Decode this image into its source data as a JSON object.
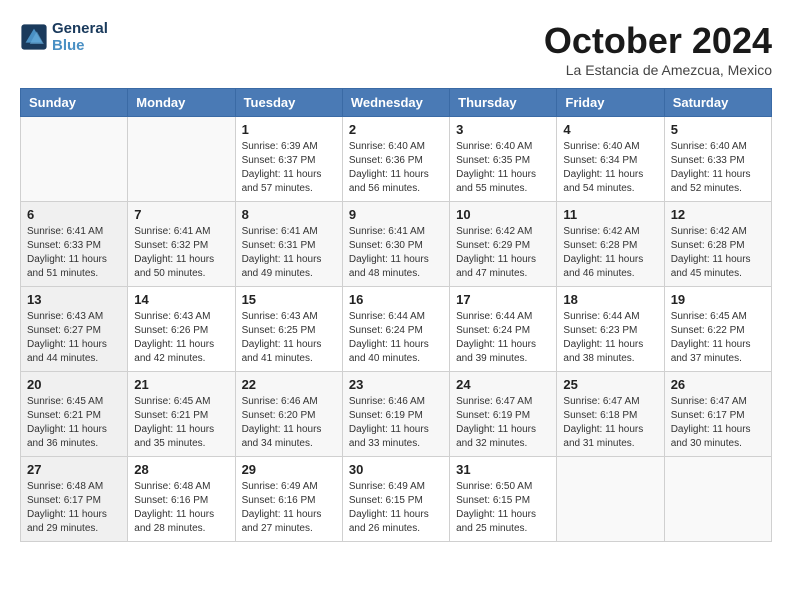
{
  "header": {
    "logo_line1": "General",
    "logo_line2": "Blue",
    "month": "October 2024",
    "location": "La Estancia de Amezcua, Mexico"
  },
  "weekdays": [
    "Sunday",
    "Monday",
    "Tuesday",
    "Wednesday",
    "Thursday",
    "Friday",
    "Saturday"
  ],
  "weeks": [
    [
      {
        "day": "",
        "sunrise": "",
        "sunset": "",
        "daylight": ""
      },
      {
        "day": "",
        "sunrise": "",
        "sunset": "",
        "daylight": ""
      },
      {
        "day": "1",
        "sunrise": "Sunrise: 6:39 AM",
        "sunset": "Sunset: 6:37 PM",
        "daylight": "Daylight: 11 hours and 57 minutes."
      },
      {
        "day": "2",
        "sunrise": "Sunrise: 6:40 AM",
        "sunset": "Sunset: 6:36 PM",
        "daylight": "Daylight: 11 hours and 56 minutes."
      },
      {
        "day": "3",
        "sunrise": "Sunrise: 6:40 AM",
        "sunset": "Sunset: 6:35 PM",
        "daylight": "Daylight: 11 hours and 55 minutes."
      },
      {
        "day": "4",
        "sunrise": "Sunrise: 6:40 AM",
        "sunset": "Sunset: 6:34 PM",
        "daylight": "Daylight: 11 hours and 54 minutes."
      },
      {
        "day": "5",
        "sunrise": "Sunrise: 6:40 AM",
        "sunset": "Sunset: 6:33 PM",
        "daylight": "Daylight: 11 hours and 52 minutes."
      }
    ],
    [
      {
        "day": "6",
        "sunrise": "Sunrise: 6:41 AM",
        "sunset": "Sunset: 6:33 PM",
        "daylight": "Daylight: 11 hours and 51 minutes."
      },
      {
        "day": "7",
        "sunrise": "Sunrise: 6:41 AM",
        "sunset": "Sunset: 6:32 PM",
        "daylight": "Daylight: 11 hours and 50 minutes."
      },
      {
        "day": "8",
        "sunrise": "Sunrise: 6:41 AM",
        "sunset": "Sunset: 6:31 PM",
        "daylight": "Daylight: 11 hours and 49 minutes."
      },
      {
        "day": "9",
        "sunrise": "Sunrise: 6:41 AM",
        "sunset": "Sunset: 6:30 PM",
        "daylight": "Daylight: 11 hours and 48 minutes."
      },
      {
        "day": "10",
        "sunrise": "Sunrise: 6:42 AM",
        "sunset": "Sunset: 6:29 PM",
        "daylight": "Daylight: 11 hours and 47 minutes."
      },
      {
        "day": "11",
        "sunrise": "Sunrise: 6:42 AM",
        "sunset": "Sunset: 6:28 PM",
        "daylight": "Daylight: 11 hours and 46 minutes."
      },
      {
        "day": "12",
        "sunrise": "Sunrise: 6:42 AM",
        "sunset": "Sunset: 6:28 PM",
        "daylight": "Daylight: 11 hours and 45 minutes."
      }
    ],
    [
      {
        "day": "13",
        "sunrise": "Sunrise: 6:43 AM",
        "sunset": "Sunset: 6:27 PM",
        "daylight": "Daylight: 11 hours and 44 minutes."
      },
      {
        "day": "14",
        "sunrise": "Sunrise: 6:43 AM",
        "sunset": "Sunset: 6:26 PM",
        "daylight": "Daylight: 11 hours and 42 minutes."
      },
      {
        "day": "15",
        "sunrise": "Sunrise: 6:43 AM",
        "sunset": "Sunset: 6:25 PM",
        "daylight": "Daylight: 11 hours and 41 minutes."
      },
      {
        "day": "16",
        "sunrise": "Sunrise: 6:44 AM",
        "sunset": "Sunset: 6:24 PM",
        "daylight": "Daylight: 11 hours and 40 minutes."
      },
      {
        "day": "17",
        "sunrise": "Sunrise: 6:44 AM",
        "sunset": "Sunset: 6:24 PM",
        "daylight": "Daylight: 11 hours and 39 minutes."
      },
      {
        "day": "18",
        "sunrise": "Sunrise: 6:44 AM",
        "sunset": "Sunset: 6:23 PM",
        "daylight": "Daylight: 11 hours and 38 minutes."
      },
      {
        "day": "19",
        "sunrise": "Sunrise: 6:45 AM",
        "sunset": "Sunset: 6:22 PM",
        "daylight": "Daylight: 11 hours and 37 minutes."
      }
    ],
    [
      {
        "day": "20",
        "sunrise": "Sunrise: 6:45 AM",
        "sunset": "Sunset: 6:21 PM",
        "daylight": "Daylight: 11 hours and 36 minutes."
      },
      {
        "day": "21",
        "sunrise": "Sunrise: 6:45 AM",
        "sunset": "Sunset: 6:21 PM",
        "daylight": "Daylight: 11 hours and 35 minutes."
      },
      {
        "day": "22",
        "sunrise": "Sunrise: 6:46 AM",
        "sunset": "Sunset: 6:20 PM",
        "daylight": "Daylight: 11 hours and 34 minutes."
      },
      {
        "day": "23",
        "sunrise": "Sunrise: 6:46 AM",
        "sunset": "Sunset: 6:19 PM",
        "daylight": "Daylight: 11 hours and 33 minutes."
      },
      {
        "day": "24",
        "sunrise": "Sunrise: 6:47 AM",
        "sunset": "Sunset: 6:19 PM",
        "daylight": "Daylight: 11 hours and 32 minutes."
      },
      {
        "day": "25",
        "sunrise": "Sunrise: 6:47 AM",
        "sunset": "Sunset: 6:18 PM",
        "daylight": "Daylight: 11 hours and 31 minutes."
      },
      {
        "day": "26",
        "sunrise": "Sunrise: 6:47 AM",
        "sunset": "Sunset: 6:17 PM",
        "daylight": "Daylight: 11 hours and 30 minutes."
      }
    ],
    [
      {
        "day": "27",
        "sunrise": "Sunrise: 6:48 AM",
        "sunset": "Sunset: 6:17 PM",
        "daylight": "Daylight: 11 hours and 29 minutes."
      },
      {
        "day": "28",
        "sunrise": "Sunrise: 6:48 AM",
        "sunset": "Sunset: 6:16 PM",
        "daylight": "Daylight: 11 hours and 28 minutes."
      },
      {
        "day": "29",
        "sunrise": "Sunrise: 6:49 AM",
        "sunset": "Sunset: 6:16 PM",
        "daylight": "Daylight: 11 hours and 27 minutes."
      },
      {
        "day": "30",
        "sunrise": "Sunrise: 6:49 AM",
        "sunset": "Sunset: 6:15 PM",
        "daylight": "Daylight: 11 hours and 26 minutes."
      },
      {
        "day": "31",
        "sunrise": "Sunrise: 6:50 AM",
        "sunset": "Sunset: 6:15 PM",
        "daylight": "Daylight: 11 hours and 25 minutes."
      },
      {
        "day": "",
        "sunrise": "",
        "sunset": "",
        "daylight": ""
      },
      {
        "day": "",
        "sunrise": "",
        "sunset": "",
        "daylight": ""
      }
    ]
  ]
}
